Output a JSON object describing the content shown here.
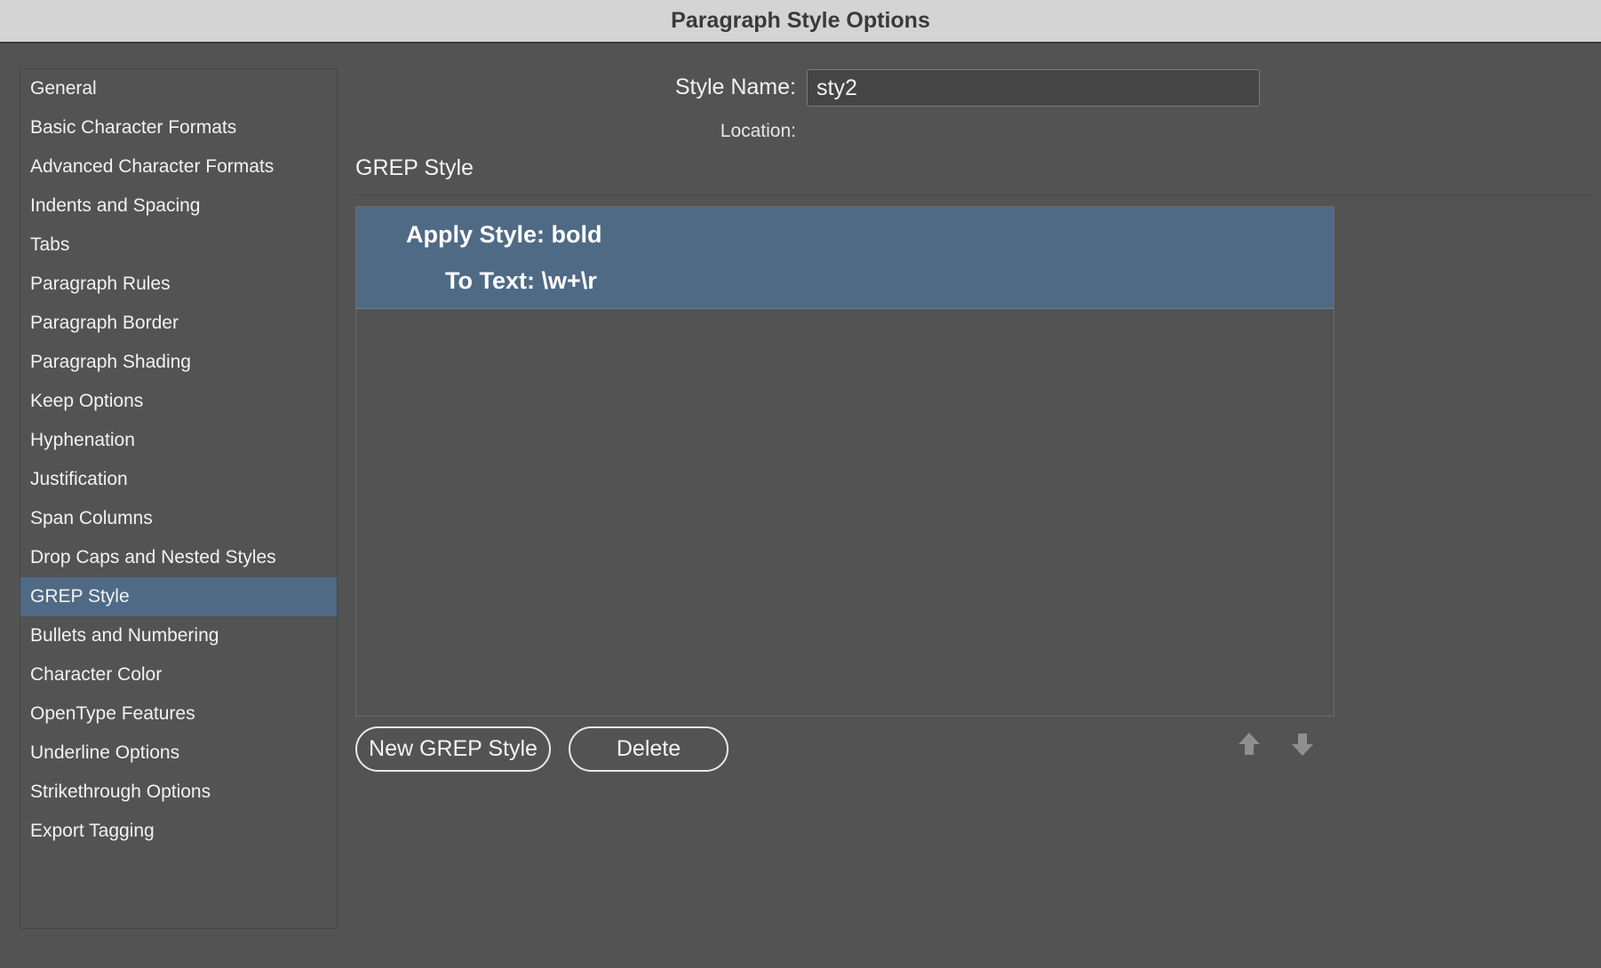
{
  "window": {
    "title": "Paragraph Style Options"
  },
  "sidebar": {
    "items": [
      {
        "label": "General"
      },
      {
        "label": "Basic Character Formats"
      },
      {
        "label": "Advanced Character Formats"
      },
      {
        "label": "Indents and Spacing"
      },
      {
        "label": "Tabs"
      },
      {
        "label": "Paragraph Rules"
      },
      {
        "label": "Paragraph Border"
      },
      {
        "label": "Paragraph Shading"
      },
      {
        "label": "Keep Options"
      },
      {
        "label": "Hyphenation"
      },
      {
        "label": "Justification"
      },
      {
        "label": "Span Columns"
      },
      {
        "label": "Drop Caps and Nested Styles"
      },
      {
        "label": "GREP Style"
      },
      {
        "label": "Bullets and Numbering"
      },
      {
        "label": "Character Color"
      },
      {
        "label": "OpenType Features"
      },
      {
        "label": "Underline Options"
      },
      {
        "label": "Strikethrough Options"
      },
      {
        "label": "Export Tagging"
      }
    ],
    "selected_label": "GREP Style"
  },
  "style_name": {
    "label": "Style Name:",
    "value": "sty2"
  },
  "location": {
    "label": "Location:"
  },
  "section": {
    "title": "GREP Style"
  },
  "grep_styles": [
    {
      "apply_label": "Apply Style: bold",
      "to_text_label": "To Text: \\w+\\r"
    }
  ],
  "buttons": {
    "new_grep_style": "New GREP Style",
    "delete": "Delete"
  },
  "icons": {
    "move_up": "arrow-up-icon",
    "move_down": "arrow-down-icon"
  },
  "colors": {
    "background": "#535353",
    "selection": "#4f6a85",
    "titlebar": "#d4d4d4"
  }
}
